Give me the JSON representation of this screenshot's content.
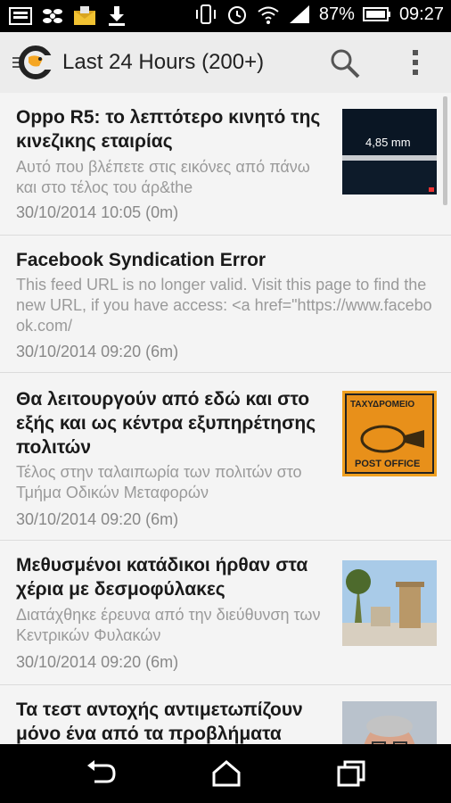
{
  "status_bar": {
    "left_icons": [
      "image-icon",
      "pinwheel-icon",
      "mail-icon",
      "download-icon"
    ],
    "right_icons": [
      "vibrate-icon",
      "alarm-icon",
      "wifi-icon",
      "signal-icon",
      "battery-icon"
    ],
    "battery_percent": "87%",
    "time": "09:27"
  },
  "app_bar": {
    "title": "Last 24 Hours (200+)",
    "icons": [
      "app-logo-icon",
      "search-icon",
      "overflow-menu-icon"
    ]
  },
  "feed": {
    "items": [
      {
        "title": "Oppo R5: το λεπτότερο κινητό της κινεζικης εταιρίας",
        "description": "Αυτό που βλέπετε στις εικόνες από πάνω και στο τέλος του άρ&the",
        "time": "30/10/2014 10:05 (0m)",
        "thumbnail_text": "4,85 mm"
      },
      {
        "title": "Facebook Syndication Error",
        "description": "This feed URL is no longer valid. Visit this page to find the new URL, if you have access: <a href=\"https://www.facebook.com/",
        "time": "30/10/2014 09:20 (6m)"
      },
      {
        "title": "Θα λειτουργούν από εδώ και στο εξής και ως κέντρα εξυπηρέτησης πολιτών",
        "description": "Τέλος στην ταλαιπωρία των πολιτών στο Τμήμα Οδικών Μεταφορών",
        "time": "30/10/2014 09:20 (6m)",
        "thumbnail_text_top": "ΤΑΧΥΔΡΟΜΕΙΟ",
        "thumbnail_text_bottom": "POST OFFICE"
      },
      {
        "title": "Μεθυσμένοι κατάδικοι ήρθαν στα χέρια με δεσμοφύλακες",
        "description": "Διατάχθηκε έρευνα από την διεύθυνση των Κεντρικών Φυλακών",
        "time": "30/10/2014 09:20 (6m)"
      },
      {
        "title": "Τα τεστ αντοχής αντιμετωπίζουν μόνο ένα από τα προβλήματα"
      }
    ]
  },
  "nav_bar": {
    "icons": [
      "back-icon",
      "home-icon",
      "recent-apps-icon"
    ]
  },
  "colors": {
    "status_bar": "#000000",
    "app_bar": "#ececec",
    "feed_background": "#f4f4f4",
    "title_text": "#1a1a1a",
    "description_text": "#9a9a9a",
    "logo_accent": "#f5a623"
  }
}
